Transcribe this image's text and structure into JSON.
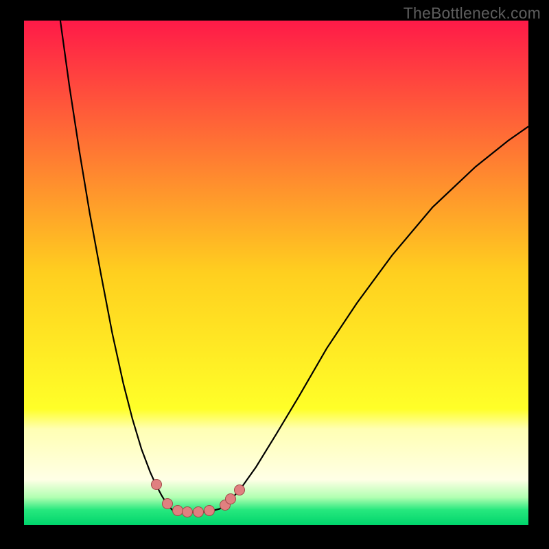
{
  "watermark": "TheBottleneck.com",
  "chart_data": {
    "type": "line",
    "title": "",
    "xlabel": "",
    "ylabel": "",
    "xlim": [
      0,
      1
    ],
    "ylim": [
      0,
      1
    ],
    "note": "V-shaped bottleneck curve over a vertical red-yellow-green gradient. Axes unlabeled; values normalized to plot-area fraction. Lower is better (green band).",
    "gradient_stops": [
      {
        "offset": 0.0,
        "color": "#ff1a48"
      },
      {
        "offset": 0.5,
        "color": "#ffcf1f"
      },
      {
        "offset": 0.77,
        "color": "#ffff28"
      },
      {
        "offset": 0.81,
        "color": "#ffffb4"
      },
      {
        "offset": 0.91,
        "color": "#ffffe6"
      },
      {
        "offset": 0.945,
        "color": "#b2ffb2"
      },
      {
        "offset": 0.97,
        "color": "#27e87e"
      },
      {
        "offset": 1.0,
        "color": "#00d56c"
      }
    ],
    "series": [
      {
        "name": "left-branch",
        "x": [
          0.072,
          0.09,
          0.11,
          0.13,
          0.152,
          0.175,
          0.197,
          0.215,
          0.233,
          0.25,
          0.26,
          0.272,
          0.284,
          0.296
        ],
        "y": [
          0.0,
          0.13,
          0.26,
          0.38,
          0.5,
          0.62,
          0.72,
          0.79,
          0.85,
          0.895,
          0.917,
          0.94,
          0.96,
          0.972
        ]
      },
      {
        "name": "valley-floor",
        "x": [
          0.296,
          0.32,
          0.345,
          0.368,
          0.388
        ],
        "y": [
          0.972,
          0.975,
          0.975,
          0.973,
          0.968
        ]
      },
      {
        "name": "right-branch",
        "x": [
          0.388,
          0.405,
          0.428,
          0.46,
          0.5,
          0.545,
          0.6,
          0.66,
          0.73,
          0.81,
          0.895,
          0.96,
          1.0
        ],
        "y": [
          0.968,
          0.955,
          0.93,
          0.885,
          0.82,
          0.745,
          0.65,
          0.56,
          0.465,
          0.37,
          0.29,
          0.238,
          0.21
        ]
      }
    ],
    "markers": [
      {
        "x": 0.262,
        "y": 0.92
      },
      {
        "x": 0.284,
        "y": 0.958
      },
      {
        "x": 0.305,
        "y": 0.972
      },
      {
        "x": 0.324,
        "y": 0.974
      },
      {
        "x": 0.345,
        "y": 0.974
      },
      {
        "x": 0.367,
        "y": 0.972
      },
      {
        "x": 0.398,
        "y": 0.96
      },
      {
        "x": 0.41,
        "y": 0.948
      },
      {
        "x": 0.427,
        "y": 0.93
      }
    ]
  }
}
